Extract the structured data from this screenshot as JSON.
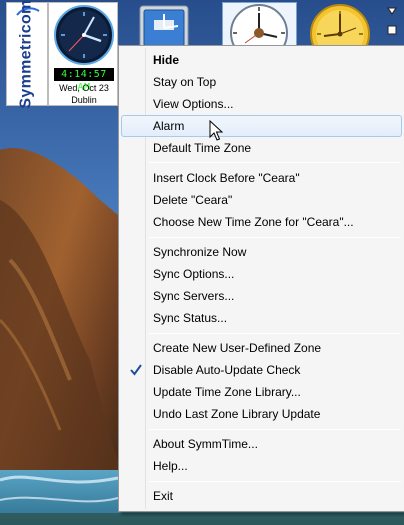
{
  "app": {
    "brand": "Symmetricom",
    "colors": {
      "brand_blue": "#1b3f8f",
      "digital_green": "#33ff33",
      "menu_bg": "#f5f5f5",
      "hover_border": "#a8c8ee"
    }
  },
  "clockbar": {
    "selected_clock": {
      "time": "4:14:57 AM",
      "date": "Wed, Oct 23",
      "city": "Dublin"
    },
    "clocks": [
      {
        "name": "dublin-clock",
        "style": "dark-analog"
      },
      {
        "name": "blue-square-clock",
        "style": "blue-square-analog"
      },
      {
        "name": "ceara-clock",
        "style": "white-analog"
      },
      {
        "name": "gold-clock",
        "style": "gold-analog"
      }
    ],
    "controls": {
      "dropdown_icon": "triangle-down-icon",
      "restore_icon": "square-icon"
    }
  },
  "menu": {
    "items": [
      {
        "label": "Hide",
        "bold": true
      },
      {
        "label": "Stay on Top"
      },
      {
        "label": "View Options..."
      },
      {
        "label": "Alarm",
        "hovered": true
      },
      {
        "label": "Default Time Zone"
      },
      {
        "label": "Insert Clock Before \"Ceara\""
      },
      {
        "label": "Delete \"Ceara\""
      },
      {
        "label": "Choose New Time Zone for \"Ceara\"..."
      },
      {
        "label": "Synchronize Now"
      },
      {
        "label": "Sync Options..."
      },
      {
        "label": "Sync Servers..."
      },
      {
        "label": "Sync Status..."
      },
      {
        "label": "Create New User-Defined Zone"
      },
      {
        "label": "Disable Auto-Update Check",
        "checked": true
      },
      {
        "label": "Update Time Zone Library..."
      },
      {
        "label": "Undo Last Zone Library Update"
      },
      {
        "label": "About SymmTime..."
      },
      {
        "label": "Help..."
      },
      {
        "label": "Exit"
      }
    ]
  }
}
